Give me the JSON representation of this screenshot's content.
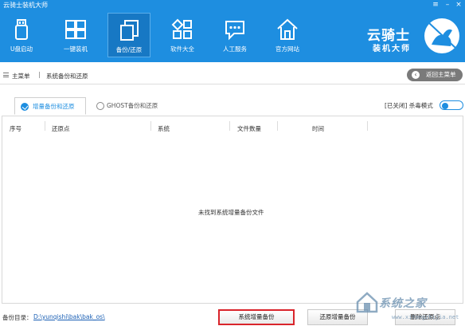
{
  "window": {
    "title": "云骑士装机大师",
    "controls": [
      "menu-icon",
      "minimize-icon",
      "close-icon"
    ]
  },
  "nav": [
    {
      "label": "U盘启动",
      "icon": "usb-drive-icon"
    },
    {
      "label": "一键装机",
      "icon": "windows-icon"
    },
    {
      "label": "备份/还原",
      "icon": "copy-backup-icon",
      "active": true
    },
    {
      "label": "软件大全",
      "icon": "apps-grid-icon"
    },
    {
      "label": "人工服务",
      "icon": "chat-bubble-icon"
    },
    {
      "label": "官方网站",
      "icon": "home-icon"
    }
  ],
  "brand": {
    "name": "云骑士",
    "subtitle": "装机大师"
  },
  "breadcrumb": {
    "root": "主菜单",
    "separator": "|",
    "current": "系统备份和还原",
    "back_label": "返回主菜单"
  },
  "tabs": [
    {
      "label": "增量备份和还原",
      "active": true
    },
    {
      "label": "GHOST备份和还原",
      "active": false
    }
  ],
  "antivirus": {
    "status": "[已关闭]",
    "label": "杀毒模式",
    "enabled": false
  },
  "table": {
    "columns": [
      "序号",
      "还原点",
      "系统",
      "文件数量",
      "时间"
    ],
    "rows": [],
    "empty_message": "未找到系统增量备份文件"
  },
  "footer": {
    "dir_label": "备份目录：",
    "dir_path": "D:\\yunqishi\\bak\\bak_os\\",
    "buttons": [
      "系统增量备份",
      "还原增量备份",
      "删除还原点"
    ]
  },
  "watermark": {
    "text": "系统之家",
    "url": "www.xitongzhijia.net"
  },
  "colors": {
    "header": "#1e8ee0",
    "header_active": "#1778c4",
    "accent": "#1e8ee0",
    "highlight_border": "#d9242b"
  }
}
